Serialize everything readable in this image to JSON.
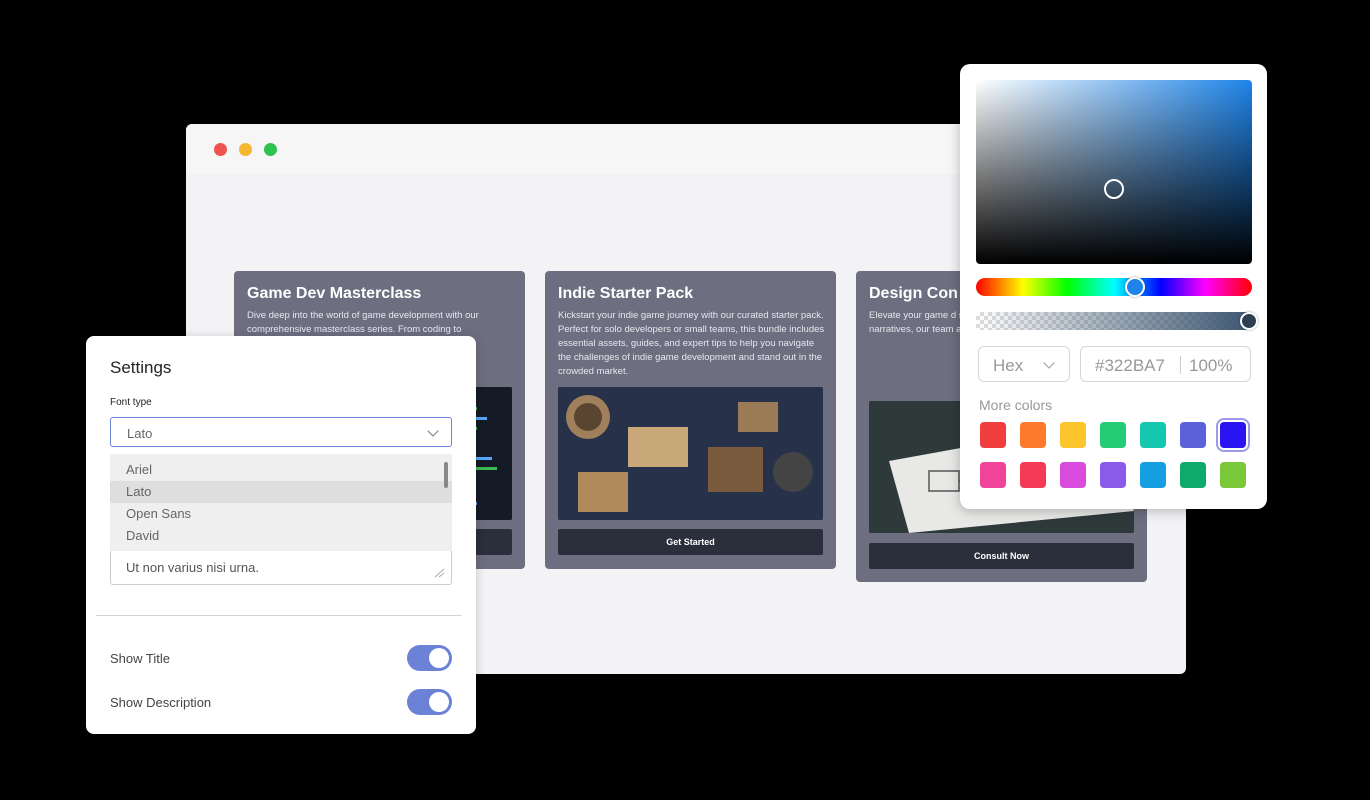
{
  "browser": {
    "cards": [
      {
        "title": "Game Dev Masterclass",
        "description": "Dive deep into the world of game development with our comprehensive masterclass series. From coding to",
        "cta": ""
      },
      {
        "title": "Indie Starter Pack",
        "description": "Kickstart your indie game journey with our curated starter pack. Perfect for solo developers or small teams, this bundle includes essential assets, guides, and expert tips to help you navigate the challenges of indie game development and stand out in the crowded market.",
        "cta": "Get Started"
      },
      {
        "title": "Design Con",
        "description": "Elevate your game d sessions from indus mechanics, polishin narratives, our team and actionable feed level.",
        "cta": "Consult Now"
      }
    ]
  },
  "settings": {
    "title": "Settings",
    "font_label": "Font type",
    "font_selected": "Lato",
    "font_options": [
      "Ariel",
      "Lato",
      "Open Sans",
      "David"
    ],
    "textarea_value": "Ut non varius nisi urna.",
    "toggles": [
      {
        "label": "Show Title",
        "on": true
      },
      {
        "label": "Show Description",
        "on": true
      }
    ]
  },
  "color_picker": {
    "format": "Hex",
    "hex": "#322BA7",
    "alpha": "100%",
    "more_colors_label": "More colors",
    "swatches_row1": [
      "#f03e3e",
      "#fd7a2c",
      "#fcc42d",
      "#23cc75",
      "#16c7b0",
      "#5b62d9",
      "#2b14f2"
    ],
    "swatches_row2": [
      "#f0449b",
      "#f53a56",
      "#d94bdd",
      "#8a5ae8",
      "#159fe0",
      "#0daa6b",
      "#7ac73a"
    ],
    "selected_swatch": "#2b14f2"
  }
}
